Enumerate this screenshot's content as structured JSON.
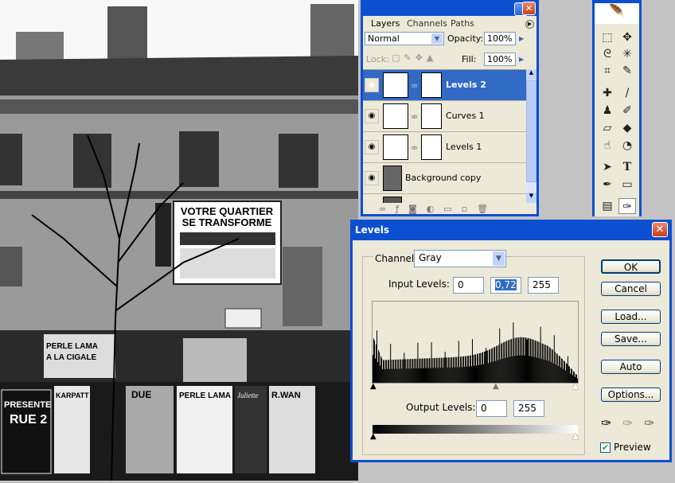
{
  "photo": {
    "poster_title_1": "VOTRE QUARTIER",
    "poster_title_2": "SE TRANSFORME",
    "poster_left": "PERLE LAMA",
    "poster_left2": "A LA CIGALE",
    "poster_presente": "PRESENTE",
    "poster_rue": "RUE 2",
    "poster_karpatt": "KARPATT",
    "poster_rwan": "R.WAN",
    "poster_due": "DUE",
    "poster_juliette": "Juliette"
  },
  "layers_panel": {
    "tabs": [
      "Layers",
      "Channels",
      "Paths"
    ],
    "blend_mode": "Normal",
    "opacity_label": "Opacity:",
    "opacity": "100%",
    "lock_label": "Lock:",
    "fill_label": "Fill:",
    "fill": "100%",
    "layers": [
      {
        "name": "Levels 2",
        "selected": true
      },
      {
        "name": "Curves 1"
      },
      {
        "name": "Levels 1"
      },
      {
        "name": "Background copy"
      }
    ]
  },
  "levels": {
    "title": "Levels",
    "channel_label": "Channel:",
    "channel": "Gray",
    "input_label": "Input Levels:",
    "input_black": "0",
    "input_gamma": "0,72",
    "input_white": "255",
    "output_label": "Output Levels:",
    "output_black": "0",
    "output_white": "255",
    "buttons": {
      "ok": "OK",
      "cancel": "Cancel",
      "load": "Load...",
      "save": "Save...",
      "auto": "Auto",
      "options": "Options..."
    },
    "preview_label": "Preview",
    "preview_checked": true,
    "close": "✕"
  },
  "colors": {
    "title_blue": "#0c4fd0",
    "selection": "#316ac5",
    "panel_bg": "#ece9d8"
  }
}
